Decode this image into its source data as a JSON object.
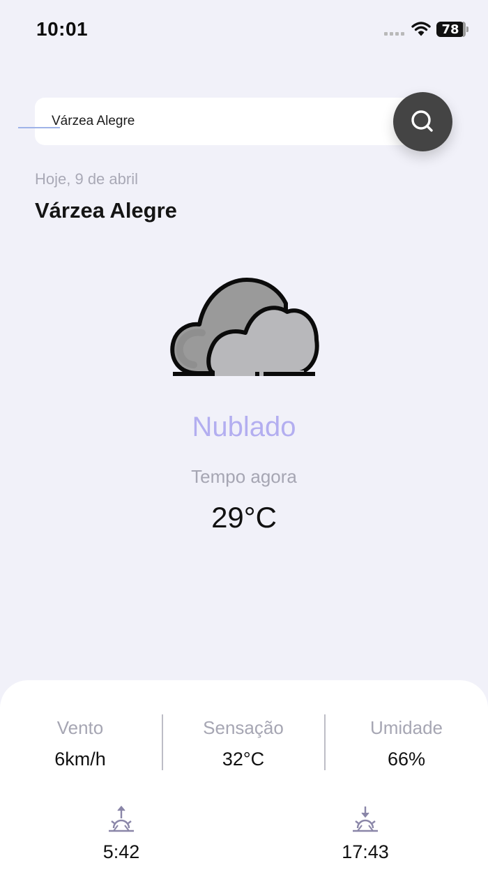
{
  "status_bar": {
    "time": "10:01",
    "battery": "78",
    "icons": [
      "signal-icon",
      "wifi-icon",
      "battery-icon"
    ]
  },
  "search": {
    "value": "Várzea Alegre",
    "button_icon": "search-icon"
  },
  "location": {
    "date": "Hoje, 9 de abril",
    "city": "Várzea Alegre"
  },
  "current": {
    "icon": "cloud-icon",
    "condition": "Nublado",
    "label": "Tempo agora",
    "temperature": "29°C"
  },
  "details": {
    "wind": {
      "label": "Vento",
      "value": "6km/h"
    },
    "feels_like": {
      "label": "Sensação",
      "value": "32°C"
    },
    "humidity": {
      "label": "Umidade",
      "value": "66%"
    }
  },
  "sun": {
    "sunrise": {
      "icon": "sunrise-icon",
      "time": "5:42"
    },
    "sunset": {
      "icon": "sunset-icon",
      "time": "17:43"
    }
  },
  "colors": {
    "background": "#f1f1f9",
    "accent": "#b3aef0",
    "muted": "#a6a6b3",
    "search_button": "#444444"
  }
}
